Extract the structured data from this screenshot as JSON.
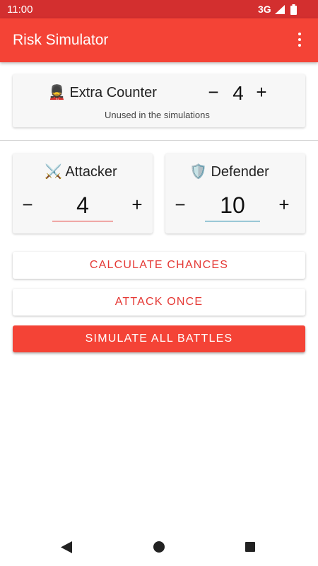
{
  "status": {
    "time": "11:00",
    "network": "3G"
  },
  "appbar": {
    "title": "Risk Simulator",
    "menu_icon": "more-vert-icon"
  },
  "extra_counter": {
    "emoji": "💂",
    "label": "Extra Counter",
    "value": "4",
    "note": "Unused in the simulations",
    "minus": "−",
    "plus": "+"
  },
  "attacker": {
    "emoji": "⚔️",
    "label": "Attacker",
    "value": "4",
    "minus": "−",
    "plus": "+",
    "underline_color": "#e53935"
  },
  "defender": {
    "emoji": "🛡️",
    "label": "Defender",
    "value": "10",
    "minus": "−",
    "plus": "+",
    "underline_color": "#1a86a8"
  },
  "buttons": {
    "calculate": "CALCULATE CHANCES",
    "attack": "ATTACK ONCE",
    "simulate": "SIMULATE ALL BATTLES"
  },
  "colors": {
    "primary": "#f44336",
    "primary_dark": "#d32f2f",
    "accent_text": "#e53935"
  }
}
